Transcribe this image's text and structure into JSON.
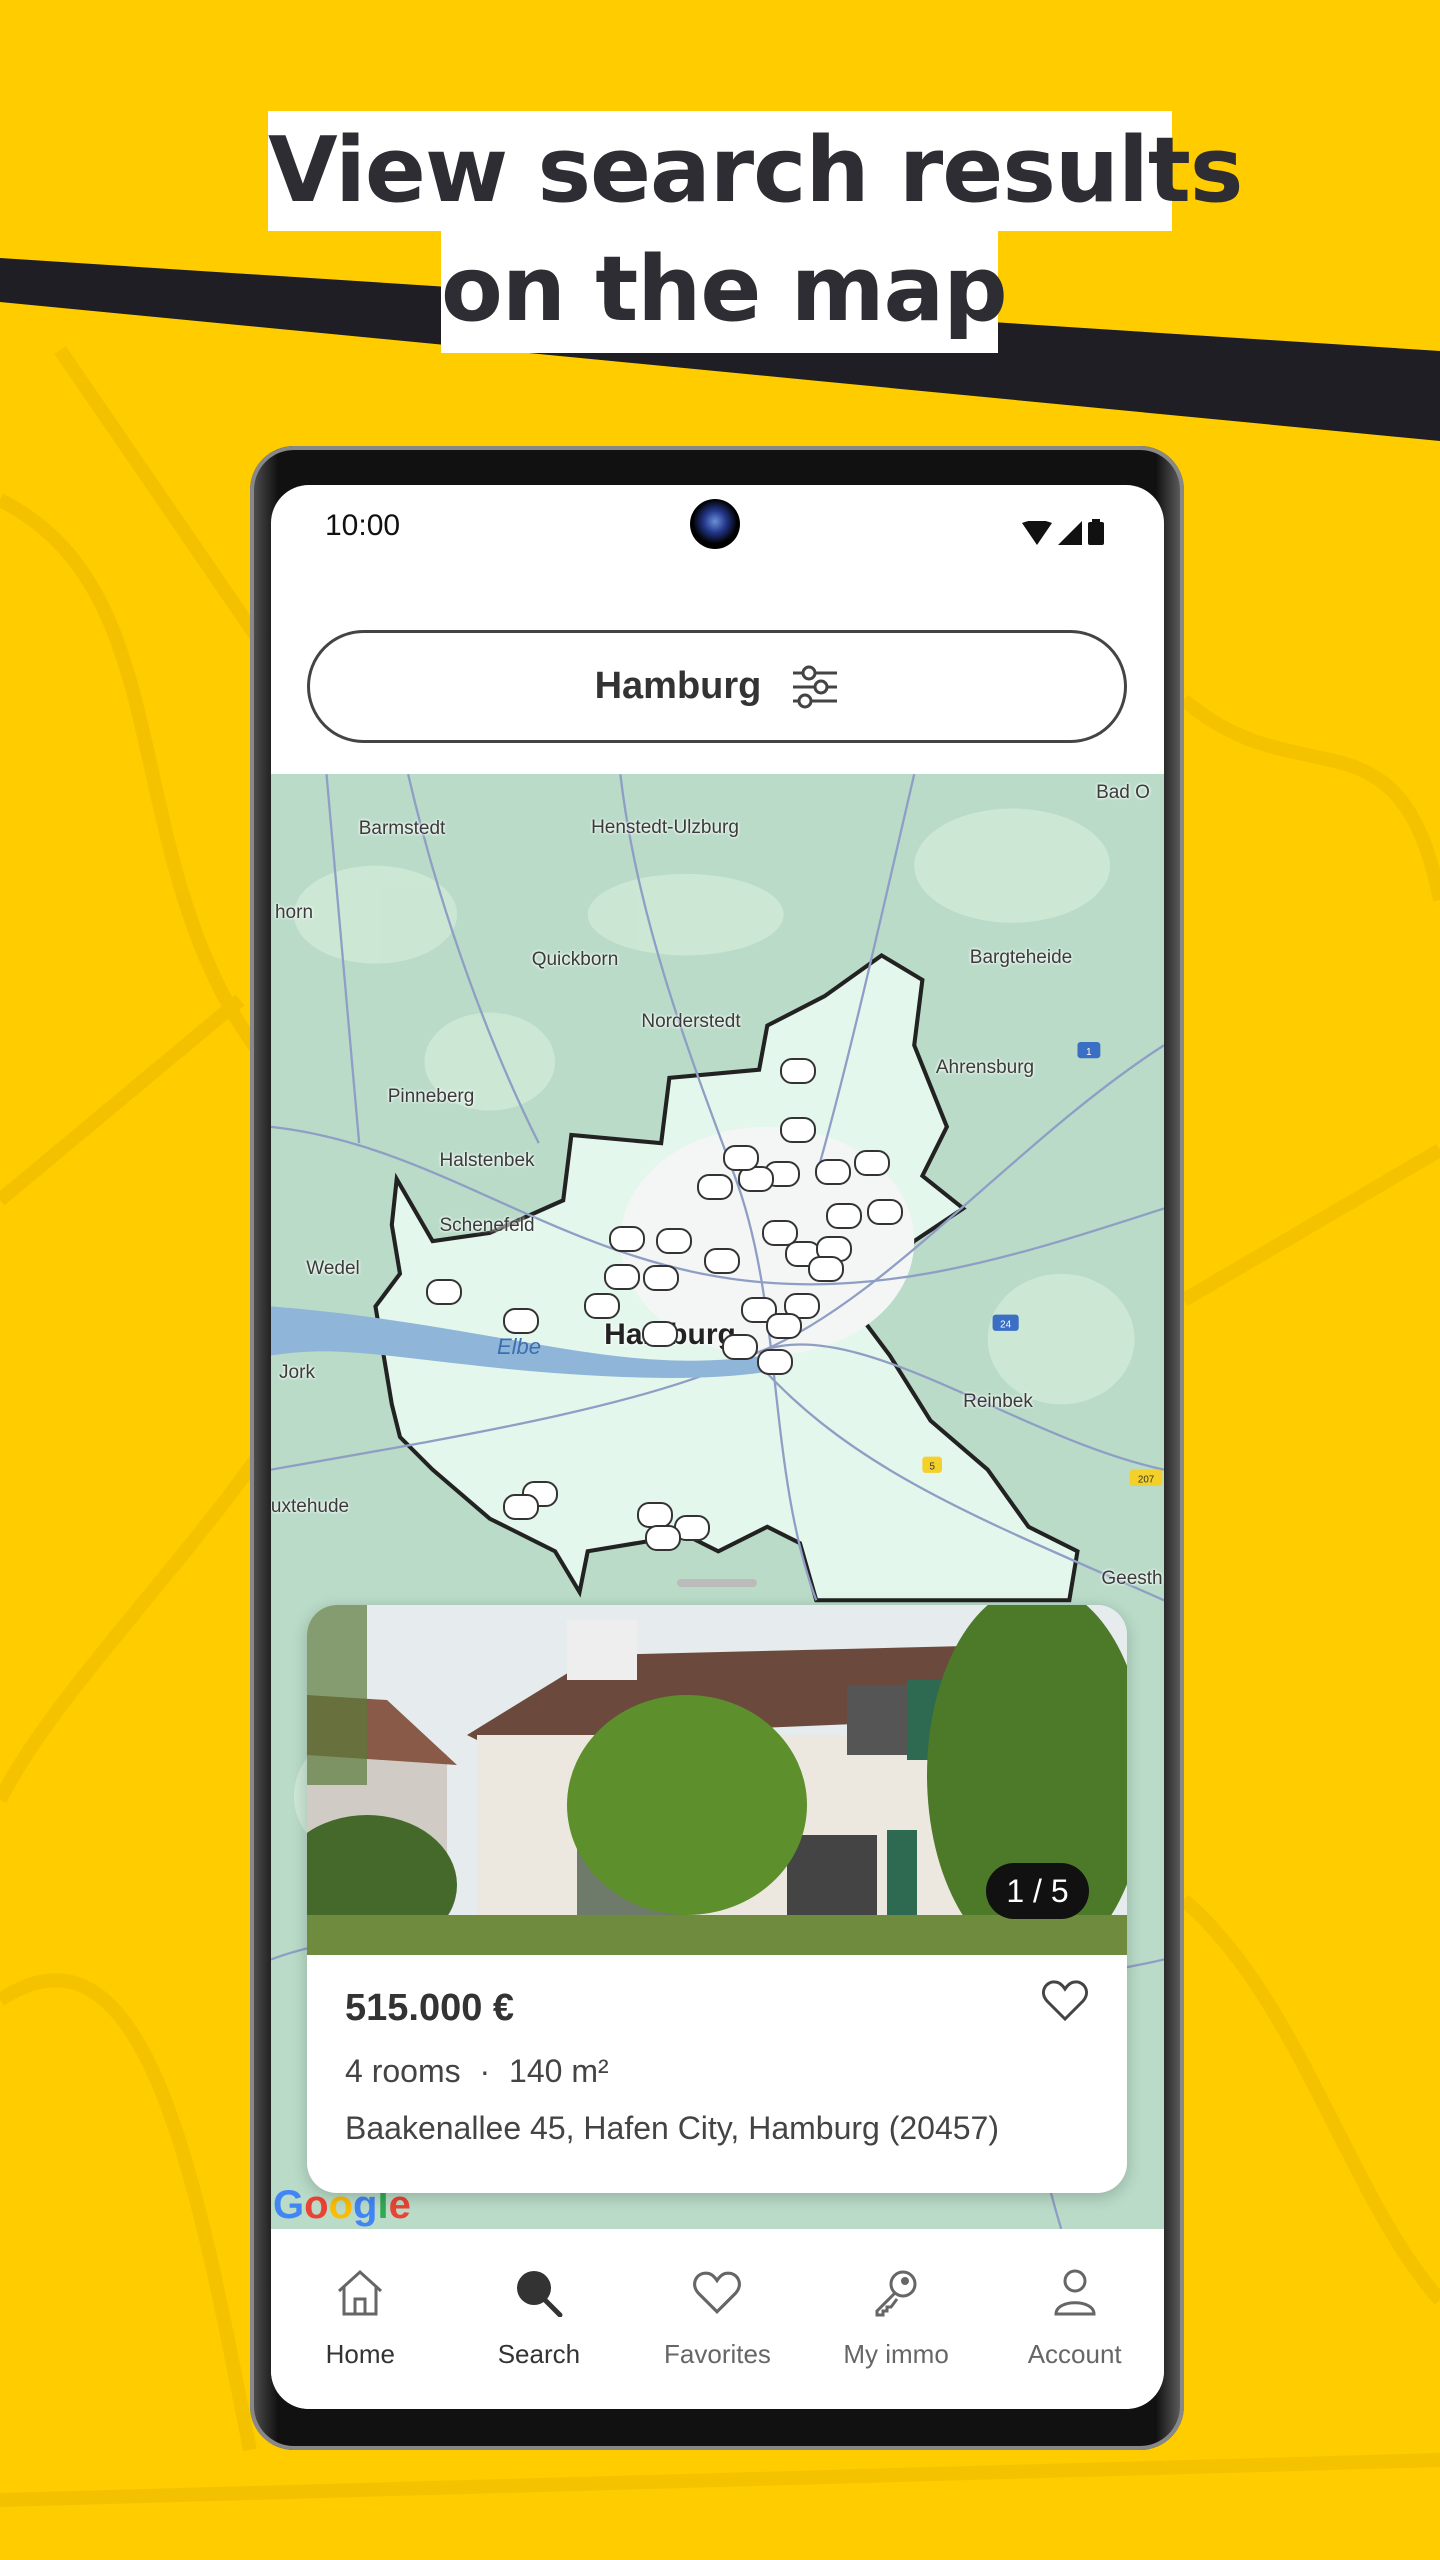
{
  "headline": {
    "line1": "View search results",
    "line2": "on the map"
  },
  "status_bar": {
    "time": "10:00",
    "icons": [
      "wifi-icon",
      "signal-icon",
      "battery-icon"
    ]
  },
  "search": {
    "location": "Hamburg",
    "filter_icon": "sliders-icon"
  },
  "map": {
    "labels": [
      "Barmstedt",
      "Henstedt-Ulzburg",
      "Bad O",
      "horn",
      "Quickborn",
      "Bargteheide",
      "Norderstedt",
      "Ahrensburg",
      "Pinneberg",
      "Halstenbek",
      "Schenefeld",
      "Wedel",
      "Elbe",
      "Hamburg",
      "Jork",
      "Reinbek",
      "uxtehude",
      "Geesth"
    ],
    "road_shields": [
      "1",
      "24",
      "5",
      "207"
    ],
    "attribution": "Google"
  },
  "listing": {
    "price": "515.000 €",
    "rooms": "4 rooms",
    "separator": "·",
    "area": "140 m²",
    "address": "Baakenallee 45, Hafen City, Hamburg (20457)",
    "image_counter": "1 / 5",
    "favorite_icon": "heart-outline-icon"
  },
  "nav": {
    "items": [
      {
        "label": "Home",
        "icon": "home-icon"
      },
      {
        "label": "Search",
        "icon": "search-icon",
        "active": true
      },
      {
        "label": "Favorites",
        "icon": "heart-icon"
      },
      {
        "label": "My immo",
        "icon": "key-icon"
      },
      {
        "label": "Account",
        "icon": "person-icon"
      }
    ]
  },
  "colors": {
    "background": "#FFCC00",
    "band": "#1e1e24",
    "text": "#333333"
  }
}
